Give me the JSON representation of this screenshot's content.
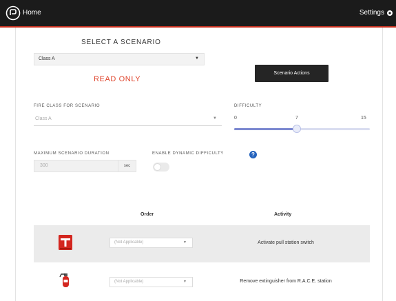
{
  "header": {
    "home_label": "Home",
    "settings_label": "Settings"
  },
  "scenario": {
    "heading": "SELECT A SCENARIO",
    "selected": "Class A",
    "read_only": "READ ONLY",
    "actions_label": "Scenario Actions"
  },
  "fire_class": {
    "label": "FIRE CLASS FOR SCENARIO",
    "value": "Class A"
  },
  "difficulty": {
    "label": "DIFFICULTY",
    "min": "0",
    "value": "7",
    "max": "15"
  },
  "duration": {
    "label": "MAXIMUM SCENARIO DURATION",
    "value": "300",
    "unit": "sec"
  },
  "dynamic_difficulty": {
    "label": "ENABLE DYNAMIC DIFFICULTY",
    "enabled": false
  },
  "table": {
    "headers": [
      "Order",
      "Activity"
    ],
    "rows": [
      {
        "icon": "pull-station-icon",
        "order": "(Not Applicable)",
        "activity": "Activate pull station switch"
      },
      {
        "icon": "fire-extinguisher-icon",
        "order": "(Not Applicable)",
        "activity": "Remove extinguisher from R.A.C.E. station"
      }
    ]
  },
  "colors": {
    "topbar": "#1b1b1b",
    "accent_red": "#e0472f",
    "slider": "#7b88d0",
    "help_blue": "#2563bd"
  }
}
